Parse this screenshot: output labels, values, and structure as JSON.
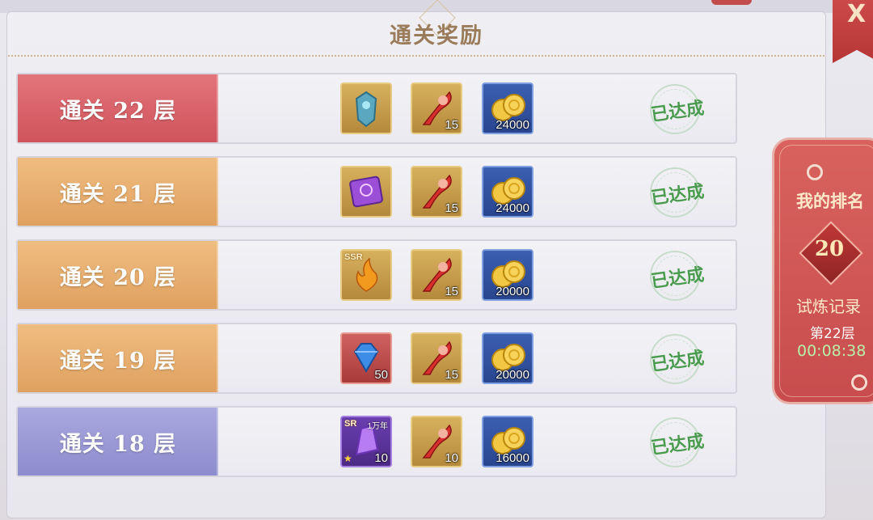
{
  "dialog": {
    "title": "通关奖励",
    "close_label": "X"
  },
  "rows": [
    {
      "label": "通关 22 层",
      "theme": "red",
      "status": "已达成",
      "rewards": [
        {
          "icon": "armor-icon",
          "frame": "gold",
          "qty": ""
        },
        {
          "icon": "red-scythe-icon",
          "frame": "gold",
          "qty": "15"
        },
        {
          "icon": "gold-coins-icon",
          "frame": "blue",
          "qty": "24000"
        }
      ]
    },
    {
      "label": "通关 21 层",
      "theme": "gold",
      "status": "已达成",
      "rewards": [
        {
          "icon": "purple-scroll-icon",
          "frame": "gold",
          "qty": ""
        },
        {
          "icon": "red-scythe-icon",
          "frame": "gold",
          "qty": "15"
        },
        {
          "icon": "gold-coins-icon",
          "frame": "blue",
          "qty": "24000"
        }
      ]
    },
    {
      "label": "通关 20 层",
      "theme": "gold",
      "status": "已达成",
      "rewards": [
        {
          "icon": "ssr-flame-icon",
          "frame": "gold",
          "qty": "",
          "tag": "SSR"
        },
        {
          "icon": "red-scythe-icon",
          "frame": "gold",
          "qty": "15"
        },
        {
          "icon": "gold-coins-icon",
          "frame": "blue",
          "qty": "20000"
        }
      ]
    },
    {
      "label": "通关 19 层",
      "theme": "gold",
      "status": "已达成",
      "rewards": [
        {
          "icon": "blue-gem-icon",
          "frame": "red",
          "qty": "50"
        },
        {
          "icon": "red-scythe-icon",
          "frame": "gold",
          "qty": "15"
        },
        {
          "icon": "gold-coins-icon",
          "frame": "blue",
          "qty": "20000"
        }
      ]
    },
    {
      "label": "通关 18 层",
      "theme": "purple",
      "status": "已达成",
      "rewards": [
        {
          "icon": "sr-purple-crystal-icon",
          "frame": "purple",
          "qty": "10",
          "tag": "SR",
          "tag2": "1万年"
        },
        {
          "icon": "red-scythe-icon",
          "frame": "gold",
          "qty": "10"
        },
        {
          "icon": "gold-coins-icon",
          "frame": "blue",
          "qty": "16000"
        }
      ]
    }
  ],
  "ranking": {
    "title": "我的排名",
    "rank": "20",
    "record_label": "试炼记录",
    "floor": "第22层",
    "time": "00:08:38"
  },
  "colors": {
    "red_row": "#d8656b",
    "gold_row": "#e6ac6c",
    "purple_row": "#9b9ad6",
    "stamp_green": "#4a9a4f",
    "rank_panel": "#d05a58"
  }
}
